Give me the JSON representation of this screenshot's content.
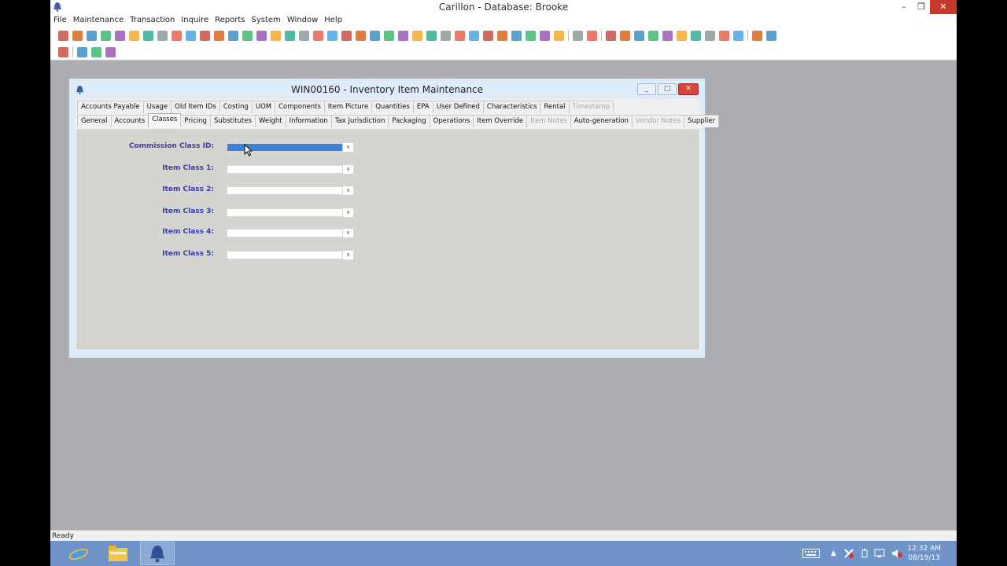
{
  "app": {
    "title": "Carillon - Database: Brooke",
    "window_controls": {
      "minimize": "–",
      "restore": "❐",
      "close": "✕"
    }
  },
  "menu": [
    "File",
    "Maintenance",
    "Transaction",
    "Inquire",
    "Reports",
    "System",
    "Window",
    "Help"
  ],
  "toolbar": {
    "row1_icons": [
      "report-icon",
      "book-icon",
      "document-icon",
      "user-icon",
      "truck-icon",
      "clipboard-icon",
      "box-icon",
      "box2-icon",
      "person-icon",
      "chart-icon",
      "key-icon",
      "page-red-icon",
      "page-red-icon",
      "page-red-icon",
      "page-red-icon",
      "page-red-icon",
      "dollar-icon",
      "tools-icon",
      "tag-icon",
      "hammer-icon",
      "globe-icon",
      "arrow-right-icon",
      "edit-icon",
      "note-icon",
      "tree-icon",
      "recycle-icon",
      "list-icon",
      "upload-icon",
      "money-icon",
      "jar-icon",
      "download-icon",
      "printer-icon",
      "card-icon",
      "card2-icon",
      "card3-icon",
      "monitor-icon",
      "sep",
      "heart-icon",
      "clock-icon",
      "sep",
      "clock2-icon",
      "window-icon",
      "windows-icon",
      "windows2-icon",
      "tree2-icon",
      "flag-icon",
      "bar-chart-icon",
      "smile-icon",
      "refresh-icon",
      "grid-icon",
      "sep",
      "help-icon",
      "barcode-icon"
    ],
    "row2_icons": [
      "broom-icon",
      "sep",
      "pencil-icon",
      "save-icon",
      "binoculars-icon"
    ]
  },
  "child_window": {
    "title": "WIN00160 - Inventory Item Maintenance",
    "controls": {
      "minimize": "_",
      "maximize": "□",
      "close": "✕"
    },
    "tabs_row1": [
      {
        "label": "Accounts Payable",
        "disabled": false
      },
      {
        "label": "Usage",
        "disabled": false
      },
      {
        "label": "Old Item IDs",
        "disabled": false
      },
      {
        "label": "Costing",
        "disabled": false
      },
      {
        "label": "UOM",
        "disabled": false
      },
      {
        "label": "Components",
        "disabled": false
      },
      {
        "label": "Item Picture",
        "disabled": false
      },
      {
        "label": "Quantities",
        "disabled": false
      },
      {
        "label": "EPA",
        "disabled": false
      },
      {
        "label": "User Defined",
        "disabled": false
      },
      {
        "label": "Characteristics",
        "disabled": false
      },
      {
        "label": "Rental",
        "disabled": false
      },
      {
        "label": "Timestamp",
        "disabled": true
      }
    ],
    "tabs_row2": [
      {
        "label": "General",
        "disabled": false
      },
      {
        "label": "Accounts",
        "disabled": false
      },
      {
        "label": "Classes",
        "disabled": false,
        "selected": true
      },
      {
        "label": "Pricing",
        "disabled": false
      },
      {
        "label": "Substitutes",
        "disabled": false
      },
      {
        "label": "Weight",
        "disabled": false
      },
      {
        "label": "Information",
        "disabled": false
      },
      {
        "label": "Tax Jurisdiction",
        "disabled": false
      },
      {
        "label": "Packaging",
        "disabled": false
      },
      {
        "label": "Operations",
        "disabled": false
      },
      {
        "label": "Item Override",
        "disabled": false
      },
      {
        "label": "Item Notes",
        "disabled": true
      },
      {
        "label": "Auto-generation",
        "disabled": false
      },
      {
        "label": "Vendor Notes",
        "disabled": true
      },
      {
        "label": "Supplier",
        "disabled": false
      }
    ],
    "fields": [
      {
        "label": "Commission Class ID:",
        "value": "",
        "focused": true
      },
      {
        "label": "Item Class 1:",
        "value": "",
        "focused": false
      },
      {
        "label": "Item Class 2:",
        "value": "",
        "focused": false
      },
      {
        "label": "Item Class 3:",
        "value": "",
        "focused": false
      },
      {
        "label": "Item Class 4:",
        "value": "",
        "focused": false
      },
      {
        "label": "Item Class 5:",
        "value": "",
        "focused": false
      }
    ],
    "dropdown_arrow": "∨"
  },
  "status": {
    "text": "Ready"
  },
  "taskbar": {
    "items": [
      "internet-explorer-icon",
      "file-explorer-icon",
      "carillon-icon"
    ],
    "tray_icons": [
      "keyboard-icon",
      "chevron-up-icon",
      "action-center-icon",
      "power-icon",
      "network-icon",
      "volume-icon"
    ],
    "time": "12:32 AM",
    "date": "08/19/13"
  },
  "colors": {
    "accent_blue": "#3c7fdc",
    "label_blue": "#3c3ca8",
    "close_red": "#c7382c",
    "taskbar": "#6f94c8"
  }
}
